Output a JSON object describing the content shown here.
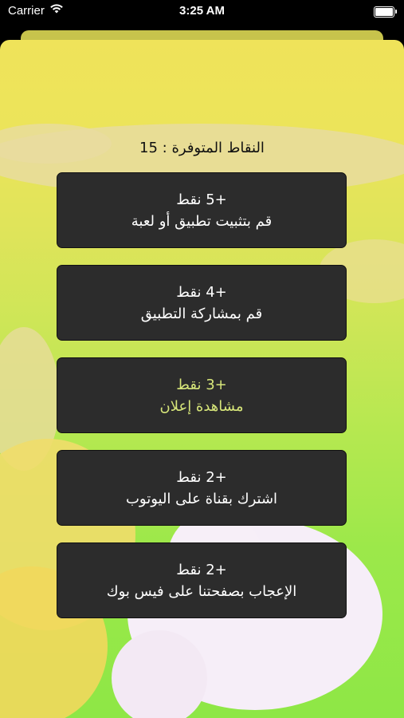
{
  "status_bar": {
    "carrier": "Carrier",
    "time": "3:25 AM",
    "battery_level": 1.0
  },
  "points": {
    "label": "النقاط المتوفرة : 15"
  },
  "options": [
    {
      "points": "+5 نقط",
      "text": "قم بتثبيت تطبيق أو لعبة",
      "highlight": false
    },
    {
      "points": "+4 نقط",
      "text": "قم بمشاركة التطبيق",
      "highlight": false
    },
    {
      "points": "+3 نقط",
      "text": "مشاهدة إعلان",
      "highlight": true
    },
    {
      "points": "+2 نقط",
      "text": "اشترك بقناة على اليوتوب",
      "highlight": false
    },
    {
      "points": "+2 نقط",
      "text": "الإعجاب بصفحتنا على فيس بوك",
      "highlight": false
    }
  ],
  "colors": {
    "button_bg": "#2c2c2c",
    "highlight_text": "#d8e77a",
    "normal_text": "#ffffff"
  }
}
